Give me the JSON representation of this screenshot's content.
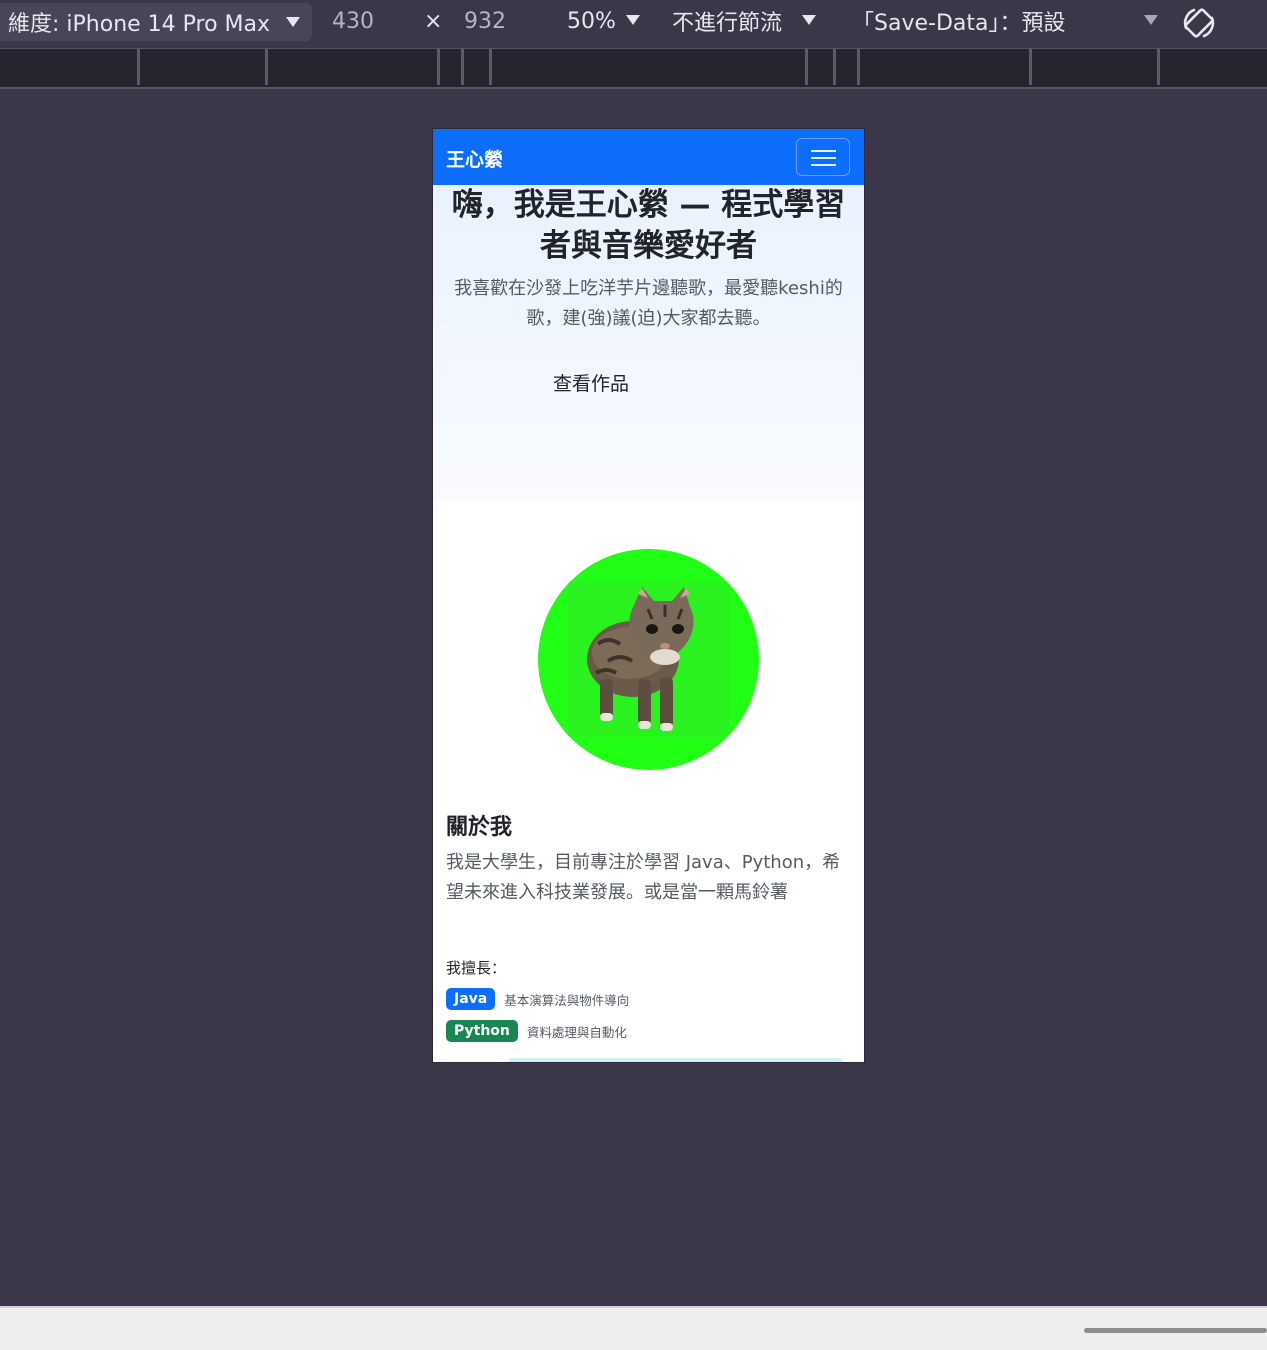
{
  "toolbar": {
    "device_label": "維度: iPhone 14 Pro Max",
    "width": "430",
    "times": "×",
    "height": "932",
    "zoom": "50%",
    "throttle": "不進行節流",
    "save_data": "「Save-Data」：預設"
  },
  "page": {
    "brand": "王心縈",
    "hero": {
      "title": "嗨，我是王心縈 — 程式學習者與音樂愛好者",
      "subtitle": "我喜歡在沙發上吃洋芋片邊聽歌，最愛聽keshi的歌，建(強)議(迫)大家都去聽。",
      "cta": "查看作品"
    },
    "about": {
      "title": "關於我",
      "text": "我是大學生，目前專注於學習 Java、Python，希望未來進入科技業發展。或是當一顆馬鈴薯",
      "skills_label": "我擅長：",
      "skills": [
        {
          "name": "Java",
          "desc": "基本演算法與物件導向",
          "color": "#0d6efd"
        },
        {
          "name": "Python",
          "desc": "資料處理與自動化",
          "color": "#198754"
        }
      ]
    }
  },
  "colors": {
    "navbar": "#0d6efd",
    "avatar_bg": "#22ff16",
    "devtools_bg": "#3c3649"
  }
}
